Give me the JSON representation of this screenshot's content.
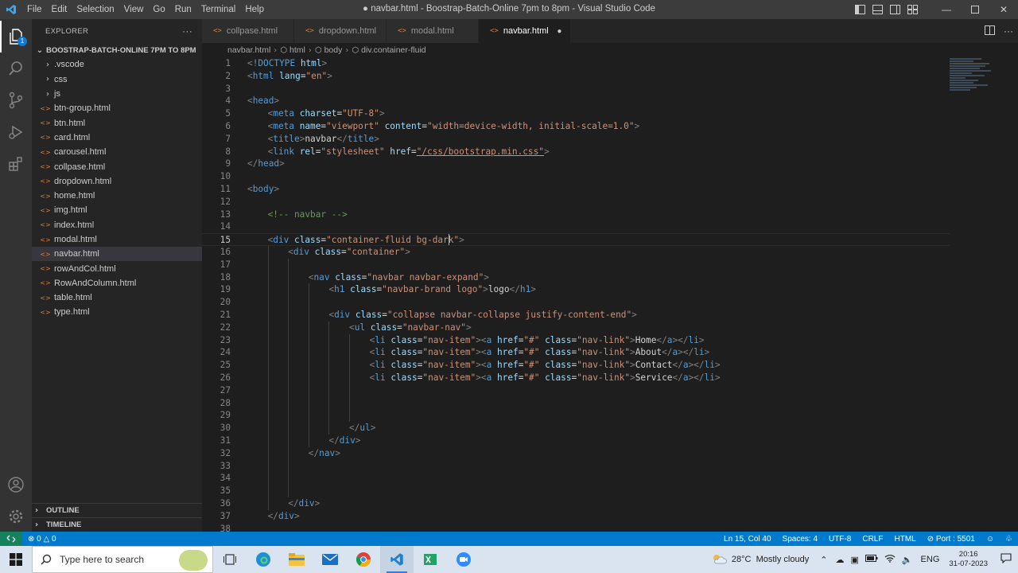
{
  "window": {
    "title": "● navbar.html - Boostrap-Batch-Online 7pm to 8pm - Visual Studio Code",
    "menu": [
      "File",
      "Edit",
      "Selection",
      "View",
      "Go",
      "Run",
      "Terminal",
      "Help"
    ]
  },
  "activity_bar": {
    "explorer_badge": "1"
  },
  "sidebar": {
    "title": "EXPLORER",
    "more": "···",
    "folder": "BOOSTRAP-BATCH-ONLINE 7PM TO 8PM",
    "items": [
      {
        "label": ".vscode",
        "kind": "folder"
      },
      {
        "label": "css",
        "kind": "folder"
      },
      {
        "label": "js",
        "kind": "folder"
      },
      {
        "label": "btn-group.html",
        "kind": "file"
      },
      {
        "label": "btn.html",
        "kind": "file"
      },
      {
        "label": "card.html",
        "kind": "file"
      },
      {
        "label": "carousel.html",
        "kind": "file"
      },
      {
        "label": "collpase.html",
        "kind": "file"
      },
      {
        "label": "dropdown.html",
        "kind": "file"
      },
      {
        "label": "home.html",
        "kind": "file"
      },
      {
        "label": "img.html",
        "kind": "file"
      },
      {
        "label": "index.html",
        "kind": "file"
      },
      {
        "label": "modal.html",
        "kind": "file"
      },
      {
        "label": "navbar.html",
        "kind": "file",
        "selected": true
      },
      {
        "label": "rowAndCol.html",
        "kind": "file"
      },
      {
        "label": "RowAndColumn.html",
        "kind": "file"
      },
      {
        "label": "table.html",
        "kind": "file"
      },
      {
        "label": "type.html",
        "kind": "file"
      }
    ],
    "outline": "OUTLINE",
    "timeline": "TIMELINE"
  },
  "tabs": [
    {
      "label": "collpase.html",
      "active": false
    },
    {
      "label": "dropdown.html",
      "active": false
    },
    {
      "label": "modal.html",
      "active": false
    },
    {
      "label": "navbar.html",
      "active": true,
      "dirty": true
    }
  ],
  "breadcrumb": [
    "navbar.html",
    "html",
    "body",
    "div.container-fluid"
  ],
  "code": {
    "current_line": 15,
    "lines": [
      {
        "n": "1",
        "indent": 0,
        "tokens": [
          [
            "p",
            "<"
          ],
          [
            "k",
            "!DOCTYPE"
          ],
          [
            "x",
            " "
          ],
          [
            "a",
            "html"
          ],
          [
            "p",
            ">"
          ]
        ]
      },
      {
        "n": "2",
        "indent": 0,
        "tokens": [
          [
            "p",
            "<"
          ],
          [
            "t",
            "html"
          ],
          [
            "x",
            " "
          ],
          [
            "a",
            "lang"
          ],
          [
            "x",
            "="
          ],
          [
            "s",
            "\"en\""
          ],
          [
            "p",
            ">"
          ]
        ]
      },
      {
        "n": "3",
        "indent": 0,
        "tokens": []
      },
      {
        "n": "4",
        "indent": 0,
        "tokens": [
          [
            "p",
            "<"
          ],
          [
            "t",
            "head"
          ],
          [
            "p",
            ">"
          ]
        ]
      },
      {
        "n": "5",
        "indent": 1,
        "tokens": [
          [
            "p",
            "<"
          ],
          [
            "t",
            "meta"
          ],
          [
            "x",
            " "
          ],
          [
            "a",
            "charset"
          ],
          [
            "x",
            "="
          ],
          [
            "s",
            "\"UTF-8\""
          ],
          [
            "p",
            ">"
          ]
        ]
      },
      {
        "n": "6",
        "indent": 1,
        "tokens": [
          [
            "p",
            "<"
          ],
          [
            "t",
            "meta"
          ],
          [
            "x",
            " "
          ],
          [
            "a",
            "name"
          ],
          [
            "x",
            "="
          ],
          [
            "s",
            "\"viewport\""
          ],
          [
            "x",
            " "
          ],
          [
            "a",
            "content"
          ],
          [
            "x",
            "="
          ],
          [
            "s",
            "\"width=device-width, initial-scale=1.0\""
          ],
          [
            "p",
            ">"
          ]
        ]
      },
      {
        "n": "7",
        "indent": 1,
        "tokens": [
          [
            "p",
            "<"
          ],
          [
            "t",
            "title"
          ],
          [
            "p",
            ">"
          ],
          [
            "x",
            "navbar"
          ],
          [
            "p",
            "</"
          ],
          [
            "t",
            "title"
          ],
          [
            "p",
            ">"
          ]
        ]
      },
      {
        "n": "8",
        "indent": 1,
        "tokens": [
          [
            "p",
            "<"
          ],
          [
            "t",
            "link"
          ],
          [
            "x",
            " "
          ],
          [
            "a",
            "rel"
          ],
          [
            "x",
            "="
          ],
          [
            "s",
            "\"stylesheet\""
          ],
          [
            "x",
            " "
          ],
          [
            "a",
            "href"
          ],
          [
            "x",
            "="
          ],
          [
            "s",
            "\"/css/bootstrap.min.css\""
          ],
          [
            "p",
            ">"
          ]
        ]
      },
      {
        "n": "9",
        "indent": 0,
        "tokens": [
          [
            "p",
            "</"
          ],
          [
            "t",
            "head"
          ],
          [
            "p",
            ">"
          ]
        ]
      },
      {
        "n": "10",
        "indent": 0,
        "tokens": []
      },
      {
        "n": "11",
        "indent": 0,
        "tokens": [
          [
            "p",
            "<"
          ],
          [
            "t",
            "body"
          ],
          [
            "p",
            ">"
          ]
        ]
      },
      {
        "n": "12",
        "indent": 0,
        "tokens": []
      },
      {
        "n": "13",
        "indent": 1,
        "tokens": [
          [
            "c",
            "<!-- navbar -->"
          ]
        ]
      },
      {
        "n": "14",
        "indent": 0,
        "tokens": []
      },
      {
        "n": "15",
        "indent": 1,
        "tokens": [
          [
            "p",
            "<"
          ],
          [
            "t",
            "div"
          ],
          [
            "x",
            " "
          ],
          [
            "a",
            "class"
          ],
          [
            "x",
            "="
          ],
          [
            "s",
            "\"container-fluid bg-dark\""
          ],
          [
            "p",
            ">"
          ]
        ]
      },
      {
        "n": "16",
        "indent": 2,
        "tokens": [
          [
            "p",
            "<"
          ],
          [
            "t",
            "div"
          ],
          [
            "x",
            " "
          ],
          [
            "a",
            "class"
          ],
          [
            "x",
            "="
          ],
          [
            "s",
            "\"container\""
          ],
          [
            "p",
            ">"
          ]
        ]
      },
      {
        "n": "17",
        "indent": 0,
        "tokens": []
      },
      {
        "n": "18",
        "indent": 3,
        "tokens": [
          [
            "p",
            "<"
          ],
          [
            "t",
            "nav"
          ],
          [
            "x",
            " "
          ],
          [
            "a",
            "class"
          ],
          [
            "x",
            "="
          ],
          [
            "s",
            "\"navbar navbar-expand\""
          ],
          [
            "p",
            ">"
          ]
        ]
      },
      {
        "n": "19",
        "indent": 4,
        "tokens": [
          [
            "p",
            "<"
          ],
          [
            "t",
            "h1"
          ],
          [
            "x",
            " "
          ],
          [
            "a",
            "class"
          ],
          [
            "x",
            "="
          ],
          [
            "s",
            "\"navbar-brand logo\""
          ],
          [
            "p",
            ">"
          ],
          [
            "x",
            "logo"
          ],
          [
            "p",
            "</"
          ],
          [
            "t",
            "h1"
          ],
          [
            "p",
            ">"
          ]
        ]
      },
      {
        "n": "20",
        "indent": 0,
        "tokens": []
      },
      {
        "n": "21",
        "indent": 4,
        "tokens": [
          [
            "p",
            "<"
          ],
          [
            "t",
            "div"
          ],
          [
            "x",
            " "
          ],
          [
            "a",
            "class"
          ],
          [
            "x",
            "="
          ],
          [
            "s",
            "\"collapse navbar-collapse justify-content-end\""
          ],
          [
            "p",
            ">"
          ]
        ]
      },
      {
        "n": "22",
        "indent": 5,
        "tokens": [
          [
            "p",
            "<"
          ],
          [
            "t",
            "ul"
          ],
          [
            "x",
            " "
          ],
          [
            "a",
            "class"
          ],
          [
            "x",
            "="
          ],
          [
            "s",
            "\"navbar-nav\""
          ],
          [
            "p",
            ">"
          ]
        ]
      },
      {
        "n": "23",
        "indent": 6,
        "tokens": [
          [
            "p",
            "<"
          ],
          [
            "t",
            "li"
          ],
          [
            "x",
            " "
          ],
          [
            "a",
            "class"
          ],
          [
            "x",
            "="
          ],
          [
            "s",
            "\"nav-item\""
          ],
          [
            "p",
            ">"
          ],
          [
            "p",
            "<"
          ],
          [
            "t",
            "a"
          ],
          [
            "x",
            " "
          ],
          [
            "a",
            "href"
          ],
          [
            "x",
            "="
          ],
          [
            "s",
            "\"#\""
          ],
          [
            "x",
            " "
          ],
          [
            "a",
            "class"
          ],
          [
            "x",
            "="
          ],
          [
            "s",
            "\"nav-link\""
          ],
          [
            "p",
            ">"
          ],
          [
            "x",
            "Home"
          ],
          [
            "p",
            "</"
          ],
          [
            "t",
            "a"
          ],
          [
            "p",
            "></"
          ],
          [
            "t",
            "li"
          ],
          [
            "p",
            ">"
          ]
        ]
      },
      {
        "n": "24",
        "indent": 6,
        "tokens": [
          [
            "p",
            "<"
          ],
          [
            "t",
            "li"
          ],
          [
            "x",
            " "
          ],
          [
            "a",
            "class"
          ],
          [
            "x",
            "="
          ],
          [
            "s",
            "\"nav-item\""
          ],
          [
            "p",
            ">"
          ],
          [
            "p",
            "<"
          ],
          [
            "t",
            "a"
          ],
          [
            "x",
            " "
          ],
          [
            "a",
            "href"
          ],
          [
            "x",
            "="
          ],
          [
            "s",
            "\"#\""
          ],
          [
            "x",
            " "
          ],
          [
            "a",
            "class"
          ],
          [
            "x",
            "="
          ],
          [
            "s",
            "\"nav-link\""
          ],
          [
            "p",
            ">"
          ],
          [
            "x",
            "About"
          ],
          [
            "p",
            "</"
          ],
          [
            "t",
            "a"
          ],
          [
            "p",
            "></"
          ],
          [
            "t",
            "li"
          ],
          [
            "p",
            ">"
          ]
        ]
      },
      {
        "n": "25",
        "indent": 6,
        "tokens": [
          [
            "p",
            "<"
          ],
          [
            "t",
            "li"
          ],
          [
            "x",
            " "
          ],
          [
            "a",
            "class"
          ],
          [
            "x",
            "="
          ],
          [
            "s",
            "\"nav-item\""
          ],
          [
            "p",
            ">"
          ],
          [
            "p",
            "<"
          ],
          [
            "t",
            "a"
          ],
          [
            "x",
            " "
          ],
          [
            "a",
            "href"
          ],
          [
            "x",
            "="
          ],
          [
            "s",
            "\"#\""
          ],
          [
            "x",
            " "
          ],
          [
            "a",
            "class"
          ],
          [
            "x",
            "="
          ],
          [
            "s",
            "\"nav-link\""
          ],
          [
            "p",
            ">"
          ],
          [
            "x",
            "Contact"
          ],
          [
            "p",
            "</"
          ],
          [
            "t",
            "a"
          ],
          [
            "p",
            "></"
          ],
          [
            "t",
            "li"
          ],
          [
            "p",
            ">"
          ]
        ]
      },
      {
        "n": "26",
        "indent": 6,
        "tokens": [
          [
            "p",
            "<"
          ],
          [
            "t",
            "li"
          ],
          [
            "x",
            " "
          ],
          [
            "a",
            "class"
          ],
          [
            "x",
            "="
          ],
          [
            "s",
            "\"nav-item\""
          ],
          [
            "p",
            ">"
          ],
          [
            "p",
            "<"
          ],
          [
            "t",
            "a"
          ],
          [
            "x",
            " "
          ],
          [
            "a",
            "href"
          ],
          [
            "x",
            "="
          ],
          [
            "s",
            "\"#\""
          ],
          [
            "x",
            " "
          ],
          [
            "a",
            "class"
          ],
          [
            "x",
            "="
          ],
          [
            "s",
            "\"nav-link\""
          ],
          [
            "p",
            ">"
          ],
          [
            "x",
            "Service"
          ],
          [
            "p",
            "</"
          ],
          [
            "t",
            "a"
          ],
          [
            "p",
            "></"
          ],
          [
            "t",
            "li"
          ],
          [
            "p",
            ">"
          ]
        ]
      },
      {
        "n": "27",
        "indent": 0,
        "tokens": []
      },
      {
        "n": "28",
        "indent": 0,
        "tokens": []
      },
      {
        "n": "29",
        "indent": 0,
        "tokens": []
      },
      {
        "n": "30",
        "indent": 5,
        "tokens": [
          [
            "p",
            "</"
          ],
          [
            "t",
            "ul"
          ],
          [
            "p",
            ">"
          ]
        ]
      },
      {
        "n": "31",
        "indent": 4,
        "tokens": [
          [
            "p",
            "</"
          ],
          [
            "t",
            "div"
          ],
          [
            "p",
            ">"
          ]
        ]
      },
      {
        "n": "32",
        "indent": 3,
        "tokens": [
          [
            "p",
            "</"
          ],
          [
            "t",
            "nav"
          ],
          [
            "p",
            ">"
          ]
        ]
      },
      {
        "n": "33",
        "indent": 0,
        "tokens": []
      },
      {
        "n": "34",
        "indent": 0,
        "tokens": []
      },
      {
        "n": "35",
        "indent": 0,
        "tokens": []
      },
      {
        "n": "36",
        "indent": 2,
        "tokens": [
          [
            "p",
            "</"
          ],
          [
            "t",
            "div"
          ],
          [
            "p",
            ">"
          ]
        ]
      },
      {
        "n": "37",
        "indent": 1,
        "tokens": [
          [
            "p",
            "</"
          ],
          [
            "t",
            "div"
          ],
          [
            "p",
            ">"
          ]
        ]
      },
      {
        "n": "38",
        "indent": 0,
        "tokens": []
      }
    ]
  },
  "statusbar": {
    "problems": "0",
    "warnings": "0",
    "position": "Ln 15, Col 40",
    "spaces": "Spaces: 4",
    "encoding": "UTF-8",
    "eol": "CRLF",
    "language": "HTML",
    "port": "Port : 5501"
  },
  "taskbar": {
    "search_placeholder": "Type here to search",
    "weather": "28°C  Mostly cloudy",
    "lang": "ENG",
    "time": "20:16",
    "date": "31-07-2023"
  },
  "colors": {
    "accent": "#007acc",
    "tag": "#569cd6",
    "attr": "#9cdcfe",
    "string": "#ce9178",
    "comment": "#6a9955",
    "file_icon": "#e37933"
  }
}
